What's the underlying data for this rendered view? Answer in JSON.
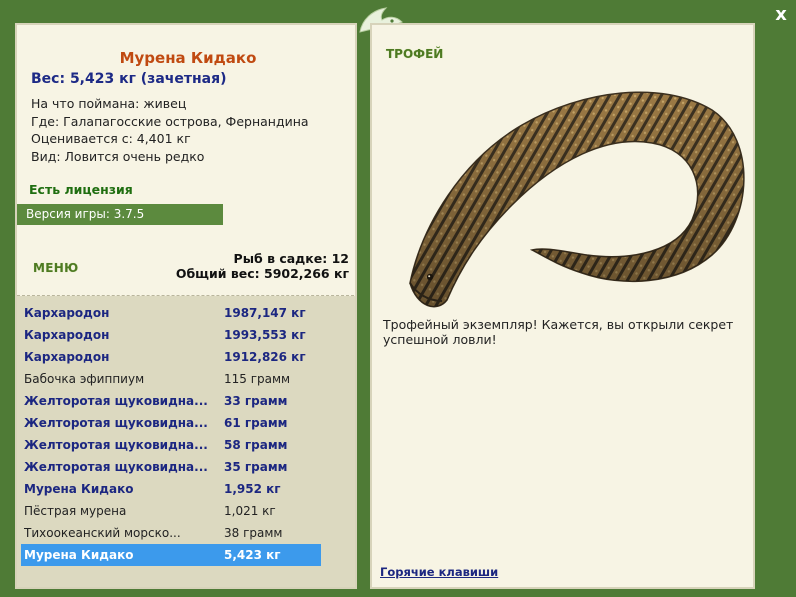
{
  "window": {
    "close_label": "x"
  },
  "fish": {
    "title": "Мурена Кидако",
    "weight": "Вес: 5,423 кг (зачетная)",
    "info": [
      "На что поймана: живец",
      "Где: Галапагосские острова, Фернандина",
      "Оценивается с: 4,401 кг",
      "Вид: Ловится очень редко"
    ],
    "license": "Есть лицензия",
    "version": "Версия игры: 3.7.5"
  },
  "menu": {
    "label": "МЕНЮ",
    "sadok_count": "Рыб в садке: 12",
    "sadok_total": "Общий вес: 5902,266 кг"
  },
  "catch_list": [
    {
      "name": "Кархародон",
      "weight": "1987,147 кг",
      "style": "b"
    },
    {
      "name": "Кархародон",
      "weight": "1993,553 кг",
      "style": "b"
    },
    {
      "name": "Кархародон",
      "weight": "1912,826 кг",
      "style": "b"
    },
    {
      "name": "Бабочка эфиппиум",
      "weight": "115 грамм",
      "style": "p"
    },
    {
      "name": "Желторотая щуковидна...",
      "weight": "33 грамм",
      "style": "b"
    },
    {
      "name": "Желторотая щуковидна...",
      "weight": "61 грамм",
      "style": "b"
    },
    {
      "name": "Желторотая щуковидна...",
      "weight": "58 грамм",
      "style": "b"
    },
    {
      "name": "Желторотая щуковидна...",
      "weight": "35 грамм",
      "style": "b"
    },
    {
      "name": "Мурена Кидако",
      "weight": "1,952 кг",
      "style": "b"
    },
    {
      "name": "Пёстрая мурена",
      "weight": "1,021 кг",
      "style": "p"
    },
    {
      "name": "Тихоокеанский морско...",
      "weight": "38 грамм",
      "style": "p"
    },
    {
      "name": "Мурена Кидако",
      "weight": "5,423 кг",
      "style": "sel"
    }
  ],
  "trophy": {
    "label": "ТРОФЕЙ",
    "description": "Трофейный экземпляр! Кажется, вы открыли секрет успешной ловли!",
    "hotkeys": "Горячие клавиши"
  },
  "colors": {
    "frame": "#4f7b36",
    "panel": "#f7f4e4",
    "selected": "#3c9aec",
    "title": "#c04a11",
    "bold_text": "#1c2781"
  },
  "icons": {
    "close": "close-icon",
    "logo": "fish-logo-icon",
    "eel": "moray-eel-image"
  }
}
